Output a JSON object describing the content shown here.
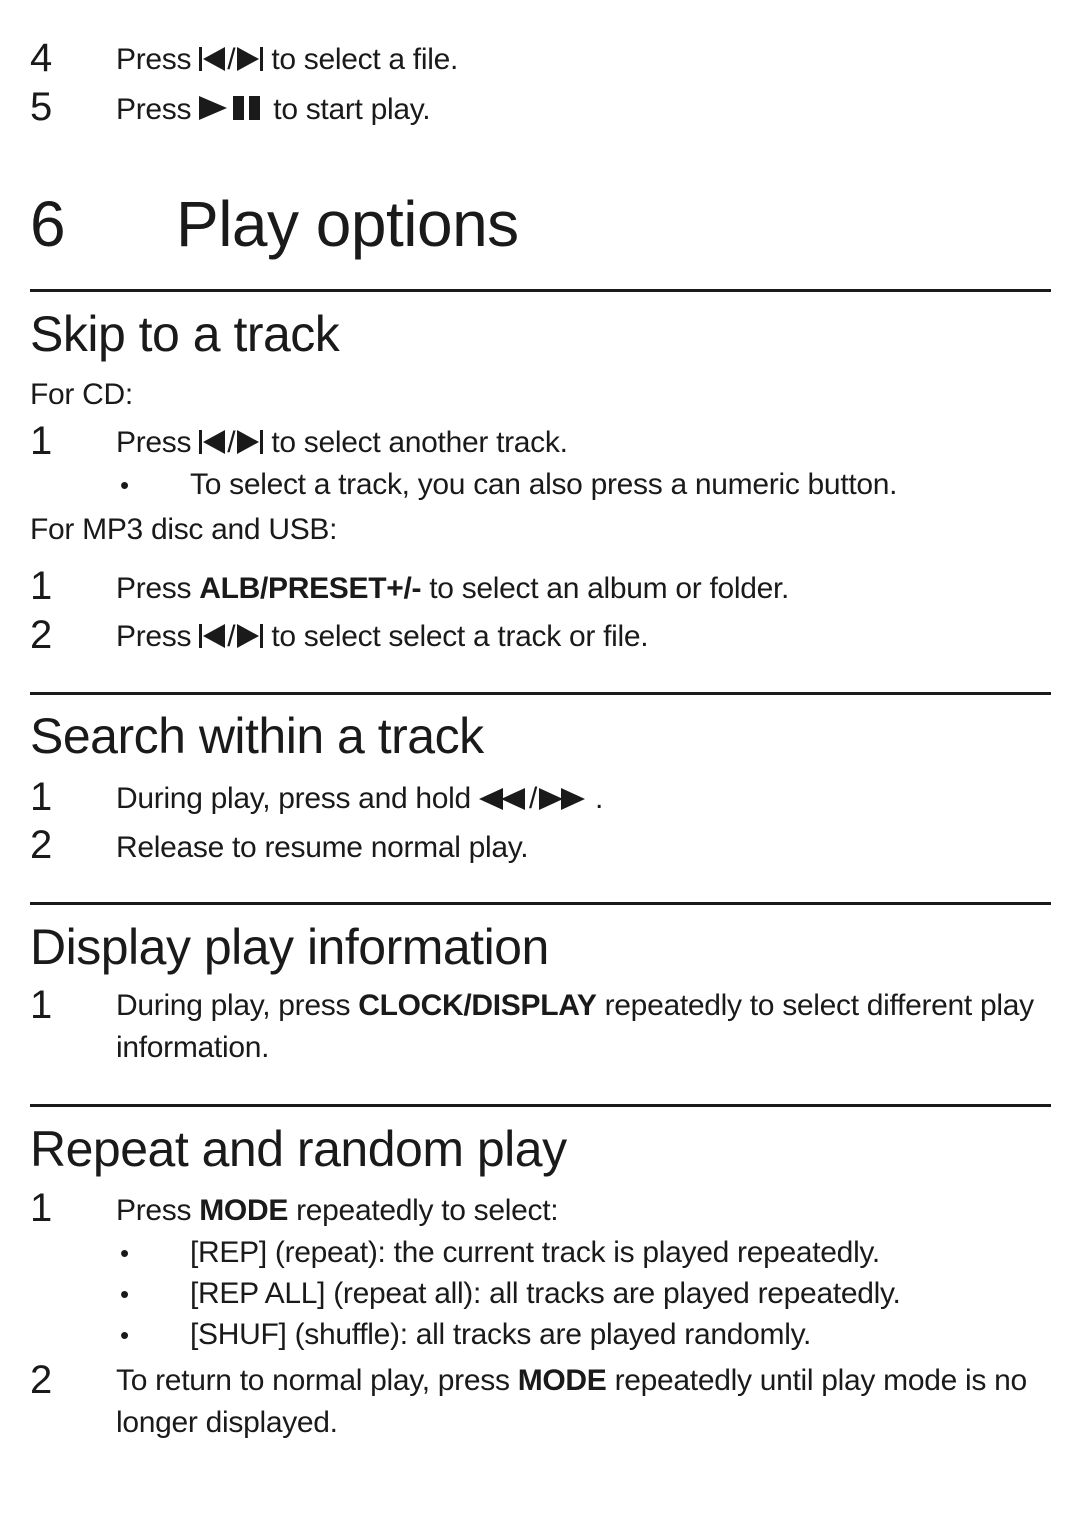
{
  "intro_steps": [
    {
      "number": "4",
      "before": "Press",
      "icons": [
        "previous-icon",
        "next-icon"
      ],
      "separator": "/",
      "after": "to select a file."
    },
    {
      "number": "5",
      "before": "Press",
      "icons": [
        "play-pause-icon"
      ],
      "after": "to start play."
    }
  ],
  "chapter": {
    "number": "6",
    "title": "Play options"
  },
  "sections": {
    "skip": {
      "title": "Skip to a track",
      "cd_label": "For CD:",
      "cd_step": {
        "number": "1",
        "before": "Press",
        "separator": "/",
        "after": "to select another track."
      },
      "cd_bullet": "To select a track, you can also press a numeric button.",
      "mp3_label": "For MP3 disc and USB:",
      "mp3_steps": [
        {
          "number": "1",
          "before": "Press",
          "bold": "ALB/PRESET+/-",
          "after": "to select an album or folder."
        },
        {
          "number": "2",
          "before": "Press",
          "separator": "/",
          "after": "to select select a track or file."
        }
      ]
    },
    "search": {
      "title": "Search within a track",
      "steps": [
        {
          "number": "1",
          "before": "During play, press and hold",
          "separator": "/",
          "after": "."
        },
        {
          "number": "2",
          "text": "Release to resume normal play."
        }
      ]
    },
    "display": {
      "title": "Display play information",
      "step": {
        "number": "1",
        "before": "During play, press",
        "bold": "CLOCK/DISPLAY",
        "after": "repeatedly to select different play information."
      }
    },
    "repeat": {
      "title": "Repeat and random play",
      "step1": {
        "number": "1",
        "before": "Press",
        "bold": "MODE",
        "after": "repeatedly to select:"
      },
      "bullets": [
        "[REP] (repeat): the current track is played repeatedly.",
        "[REP ALL] (repeat all): all tracks are played repeatedly.",
        "[SHUF] (shuffle): all tracks are played randomly."
      ],
      "step2": {
        "number": "2",
        "before": "To return to normal play, press",
        "bold": "MODE",
        "after": "repeatedly until play mode is no longer displayed."
      }
    }
  },
  "bullet_symbol": "•"
}
